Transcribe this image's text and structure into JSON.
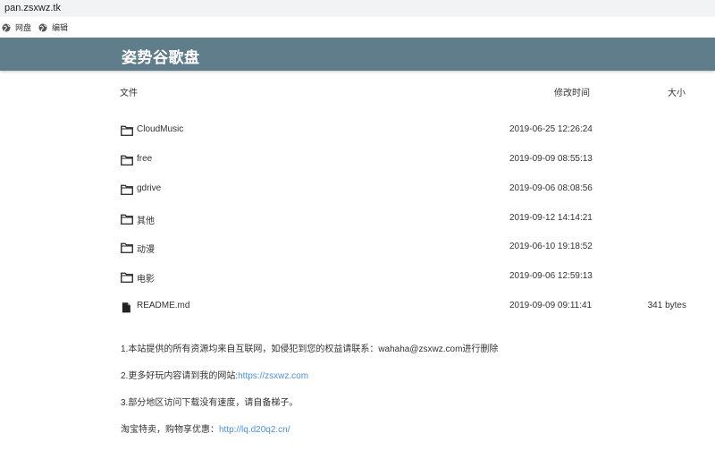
{
  "browser": {
    "url": "pan.zsxwz.tk",
    "bookmarks": [
      {
        "label": "网盘",
        "icon": "globe-icon"
      },
      {
        "label": "编辑",
        "icon": "globe-icon"
      }
    ]
  },
  "header": {
    "title": "姿势谷歌盘"
  },
  "table": {
    "columns": {
      "name": "文件",
      "modified": "修改时间",
      "size": "大小"
    },
    "rows": [
      {
        "name": "CloudMusic",
        "modified": "2019-06-25 12:26:24",
        "size": "",
        "icon": "folder-icon"
      },
      {
        "name": "free",
        "modified": "2019-09-09 08:55:13",
        "size": "",
        "icon": "folder-icon"
      },
      {
        "name": "gdrive",
        "modified": "2019-09-06 08:08:56",
        "size": "",
        "icon": "folder-icon"
      },
      {
        "name": "其他",
        "modified": "2019-09-12 14:14:21",
        "size": "",
        "icon": "folder-icon"
      },
      {
        "name": "动漫",
        "modified": "2019-06-10 19:18:52",
        "size": "",
        "icon": "folder-icon"
      },
      {
        "name": "电影",
        "modified": "2019-09-06 12:59:13",
        "size": "",
        "icon": "folder-icon"
      },
      {
        "name": "README.md",
        "modified": "2019-09-09 09:11:41",
        "size": "341 bytes",
        "icon": "file-icon"
      }
    ]
  },
  "notes": {
    "line1": "1.本站提供的所有资源均来自互联网，如侵犯到您的权益请联系：wahaha@zsxwz.com进行删除",
    "line2_prefix": "2.更多好玩内容请到我的网站:",
    "line2_link": "https://zsxwz.com",
    "line3": "3.部分地区访问下载没有速度，请自备梯子。",
    "line4_prefix": "淘宝特卖，购物享优惠：",
    "line4_link": "http://lq.d20q2.cn/"
  }
}
